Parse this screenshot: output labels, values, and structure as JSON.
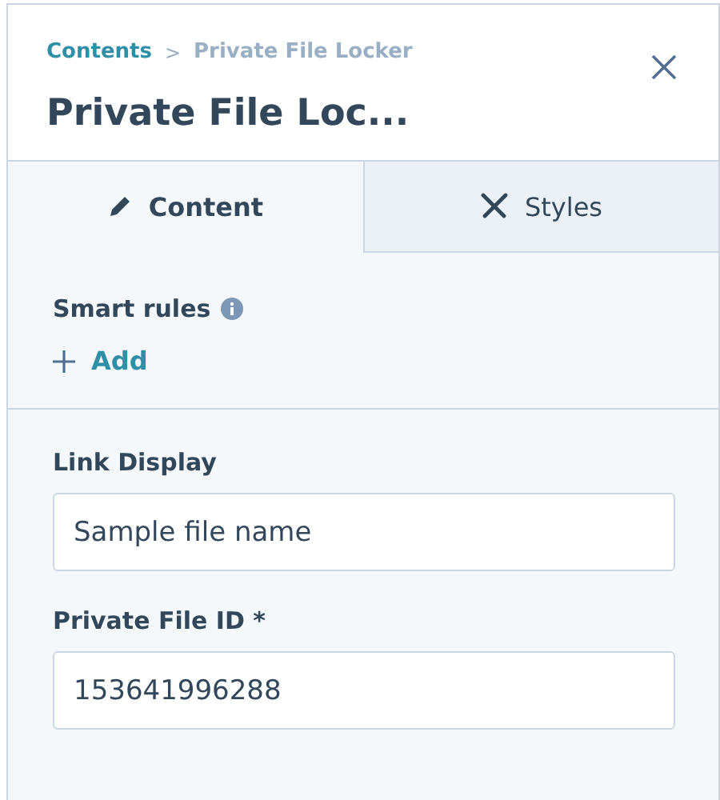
{
  "breadcrumb": {
    "parent": "Contents",
    "separator": ">",
    "current": "Private File Locker"
  },
  "title": "Private File Loc...",
  "tabs": [
    {
      "label": "Content",
      "kind": "edit",
      "selected": true
    },
    {
      "label": "Styles",
      "kind": "style",
      "selected": false
    }
  ],
  "smart_rules": {
    "label": "Smart rules",
    "add_label": "Add"
  },
  "fields": [
    {
      "label": "Link Display",
      "value": "Sample file name"
    },
    {
      "label": "Private File ID *",
      "value": "153641996288"
    }
  ]
}
